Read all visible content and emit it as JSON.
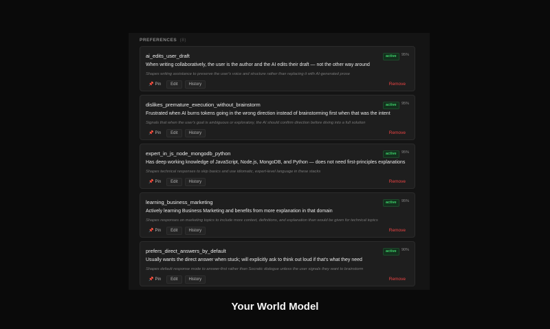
{
  "section": {
    "title": "PREFERENCES",
    "count": "(8)"
  },
  "actions": {
    "pin": "Pin",
    "edit": "Edit",
    "history": "History",
    "remove": "Remove"
  },
  "cards": [
    {
      "name": "ai_edits_user_draft",
      "badge": "active",
      "confidence": "95%",
      "description": "When writing collaboratively, the user is the author and the AI edits their draft — not the other way around",
      "subtext": "Shapes writing assistance to preserve the user's voice and structure rather than replacing it with AI-generated prose"
    },
    {
      "name": "dislikes_premature_execution_without_brainstorm",
      "badge": "active",
      "confidence": "95%",
      "description": "Frustrated when AI burns tokens going in the wrong direction instead of brainstorming first when that was the intent",
      "subtext": "Signals that when the user's goal is ambiguous or exploratory, the AI should confirm direction before diving into a full solution"
    },
    {
      "name": "expert_in_js_node_mongodb_python",
      "badge": "active",
      "confidence": "95%",
      "description": "Has deep working knowledge of JavaScript, Node.js, MongoDB, and Python — does not need first-principles explanations",
      "subtext": "Shapes technical responses to skip basics and use idiomatic, expert-level language in these stacks"
    },
    {
      "name": "learning_business_marketing",
      "badge": "active",
      "confidence": "95%",
      "description": "Actively learning Business Marketing and benefits from more explanation in that domain",
      "subtext": "Shapes responses on marketing topics to include more context, definitions, and explanation than would be given for technical topics"
    },
    {
      "name": "prefers_direct_answers_by_default",
      "badge": "active",
      "confidence": "90%",
      "description": "Usually wants the direct answer when stuck; will explicitly ask to think out loud if that's what they need",
      "subtext": "Shapes default response mode to answer-first rather than Socratic dialogue unless the user signals they want to brainstorm"
    }
  ],
  "footer": {
    "title": "Your World Model"
  },
  "colors": {
    "active_badge": "#3fd46b",
    "remove": "#ef4444",
    "background": "#0a0a0a",
    "card": "#1e1e1e"
  }
}
